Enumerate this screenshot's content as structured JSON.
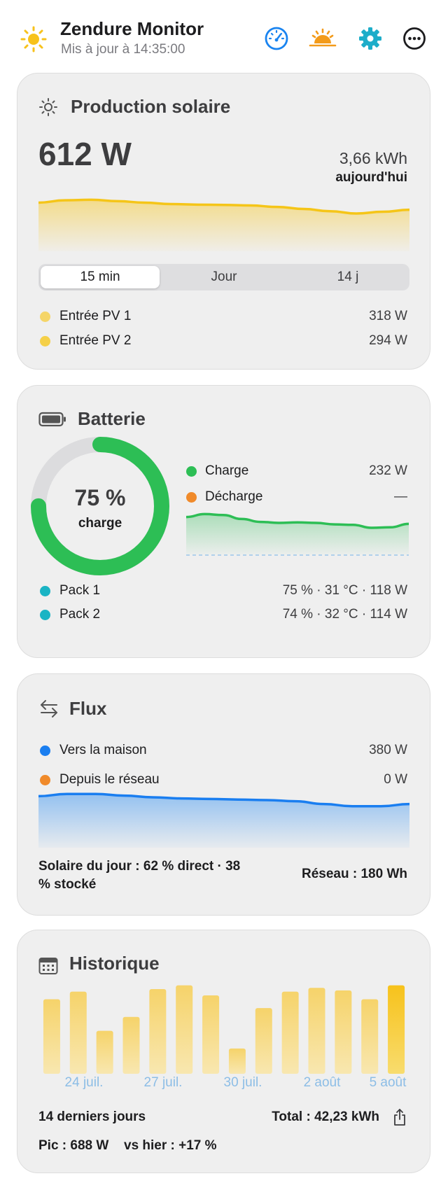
{
  "header": {
    "title": "Zendure Monitor",
    "subtitle": "Mis à jour à 14:35:00",
    "icons": [
      "sun-icon",
      "speedometer-icon",
      "sunset-icon",
      "gear-icon",
      "more-icon"
    ],
    "colors": {
      "sun": "#f7c21b",
      "speedometer": "#1a84f0",
      "sunset": "#f39b1a",
      "gear": "#1dadc9",
      "more": "#1d1d1f"
    }
  },
  "production": {
    "title": "Production solaire",
    "power": "612 W",
    "energy": "3,66 kWh",
    "energy_caption": "aujourd'hui",
    "ranges": [
      "15 min",
      "Jour",
      "14 j"
    ],
    "selected_range": "15 min",
    "inputs": [
      {
        "label": "Entrée PV 1",
        "value": "318 W",
        "color": "#f5d568"
      },
      {
        "label": "Entrée PV 2",
        "value": "294 W",
        "color": "#f5d048"
      }
    ],
    "sparkline": [
      470,
      478,
      480,
      475,
      470,
      465,
      463,
      462,
      460,
      455,
      448,
      440,
      432,
      438,
      445
    ],
    "color": "#f5c518"
  },
  "battery": {
    "title": "Batterie",
    "soc_percent": 75,
    "soc_text": "75 %",
    "soc_caption": "charge",
    "charge": {
      "label": "Charge",
      "value": "232 W",
      "color": "#2dbe55"
    },
    "discharge": {
      "label": "Décharge",
      "value": "—",
      "color": "#f08a2a"
    },
    "sparkline": [
      232,
      238,
      236,
      228,
      222,
      220,
      221,
      220,
      217,
      216,
      210,
      211,
      218
    ],
    "packs": [
      {
        "label": "Pack 1",
        "value": "75 % · 31 °C · 118 W",
        "color": "#1ab4c4"
      },
      {
        "label": "Pack 2",
        "value": "74 % · 32 °C · 114 W",
        "color": "#1ab4c4"
      }
    ],
    "ring_color": "#2dbe55"
  },
  "flux": {
    "title": "Flux",
    "to_home": {
      "label": "Vers la maison",
      "value": "380 W",
      "color": "#1a7ef0"
    },
    "from_grid": {
      "label": "Depuis le réseau",
      "value": "0 W",
      "color": "#f08a2a"
    },
    "sparkline": [
      392,
      396,
      396,
      393,
      390,
      388,
      387,
      386,
      385,
      383,
      378,
      374,
      374,
      378
    ],
    "solar_split": "Solaire du jour : 62 % direct · 38 % stocké",
    "grid_energy": "Réseau : 180 Wh",
    "color": "#1a7ef0"
  },
  "history": {
    "title": "Historique",
    "chart_data": {
      "type": "bar",
      "categories": [
        "",
        "",
        "",
        "",
        "",
        "",
        "",
        "",
        "",
        "",
        "",
        "",
        "",
        ""
      ],
      "values": [
        2.95,
        3.25,
        1.7,
        2.25,
        3.35,
        3.5,
        3.1,
        1.0,
        2.6,
        3.25,
        3.4,
        3.3,
        2.95,
        3.5
      ],
      "tick_labels": [
        "24 juil.",
        "27 juil.",
        "30 juil.",
        "2 août",
        "5 août"
      ],
      "ylim": [
        0,
        3.6
      ]
    },
    "period": "14 derniers jours",
    "total": "Total : 42,23 kWh",
    "peak": "Pic : 688 W",
    "vs_yesterday": "vs hier : +17 %"
  }
}
